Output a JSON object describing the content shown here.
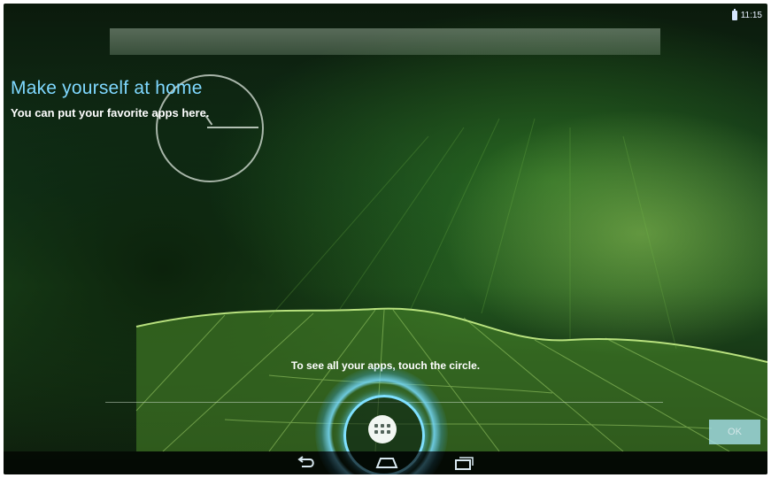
{
  "status_bar": {
    "time": "11:15",
    "icons": [
      "battery-icon"
    ]
  },
  "search_bar": {
    "icon": "search-bar"
  },
  "cling": {
    "title": "Make yourself at home",
    "text": "You can put your favorite apps here.",
    "title_color": "#7fd8ff"
  },
  "all_apps": {
    "hint": "To see all your apps, touch the circle.",
    "button_icon": "grid-icon",
    "accent": "#7fe0ff"
  },
  "ok_button": {
    "label": "OK"
  },
  "navigation": {
    "icons": [
      "back-icon",
      "home-icon",
      "recent-apps-icon"
    ]
  }
}
